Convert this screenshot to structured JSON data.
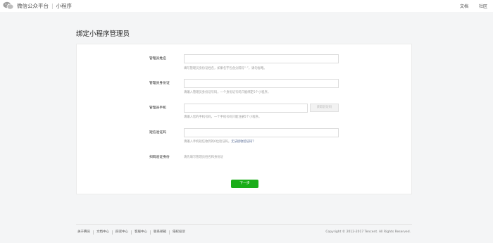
{
  "header": {
    "brand": "微信公众平台",
    "separator": "|",
    "section": "小程序",
    "links": [
      "文档",
      "社区"
    ]
  },
  "page": {
    "title": "绑定小程序管理员"
  },
  "form": {
    "fields": [
      {
        "label": "管理员姓名",
        "value": "",
        "hint": "填写管理员身份证姓名，如果名字包含分隔号“·”，请勿省略。"
      },
      {
        "label": "管理员身份证",
        "value": "",
        "hint": "请输入管理员身份证号码，一个身份证号码只能绑定5个小程序。"
      },
      {
        "label": "管理员手机",
        "value": "",
        "hint": "请输入您的手机号码，一个手机号码只能注册5个小程序。",
        "button": "获取验证码"
      },
      {
        "label": "短信验证码",
        "value": "",
        "hint": "请输入手机短信收到的6位验证码。",
        "hint_link": "无法接收验证码？"
      },
      {
        "label": "扫码验证身份",
        "note": "请先填写管理员姓名和身份证"
      }
    ],
    "next_button": "下一步"
  },
  "footer": {
    "links": [
      "关于腾讯",
      "文档中心",
      "辟谣中心",
      "客服中心",
      "联系邮箱",
      "侵权投诉"
    ],
    "copyright": "Copyright © 2012-2017 Tencent. All Rights Reserved."
  },
  "colors": {
    "accent": "#1aad19",
    "link": "#576b95",
    "background": "#f4f5f6"
  }
}
